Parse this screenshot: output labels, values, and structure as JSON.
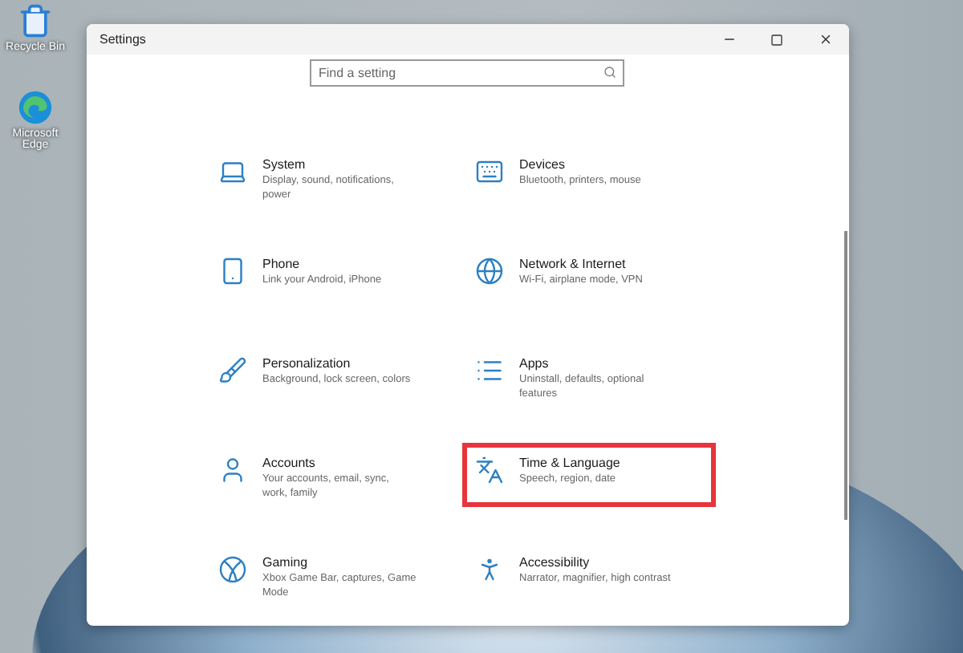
{
  "desktop_icons": [
    {
      "label": "Recycle Bin",
      "kind": "bin"
    },
    {
      "label": "Microsoft Edge",
      "kind": "browser"
    }
  ],
  "window": {
    "title": "Settings"
  },
  "search": {
    "placeholder": "Find a setting"
  },
  "categories": [
    {
      "title": "System",
      "description": "Display, sound, notifications, power",
      "kind": "system",
      "highlighted": false
    },
    {
      "title": "Devices",
      "description": "Bluetooth, printers, mouse",
      "kind": "devices",
      "highlighted": false
    },
    {
      "title": "Phone",
      "description": "Link your Android, iPhone",
      "kind": "phone",
      "highlighted": false
    },
    {
      "title": "Network & Internet",
      "description": "Wi-Fi, airplane mode, VPN",
      "kind": "network",
      "highlighted": false
    },
    {
      "title": "Personalization",
      "description": "Background, lock screen, colors",
      "kind": "personalization",
      "highlighted": false
    },
    {
      "title": "Apps",
      "description": "Uninstall, defaults, optional features",
      "kind": "apps",
      "highlighted": false
    },
    {
      "title": "Accounts",
      "description": "Your accounts, email, sync, work, family",
      "kind": "accounts",
      "highlighted": false
    },
    {
      "title": "Time & Language",
      "description": "Speech, region, date",
      "kind": "time",
      "highlighted": true
    },
    {
      "title": "Gaming",
      "description": "Xbox Game Bar, captures, Game Mode",
      "kind": "gaming",
      "highlighted": false
    },
    {
      "title": "Accessibility",
      "description": "Narrator, magnifier, high contrast",
      "kind": "accessibility",
      "highlighted": false
    }
  ]
}
